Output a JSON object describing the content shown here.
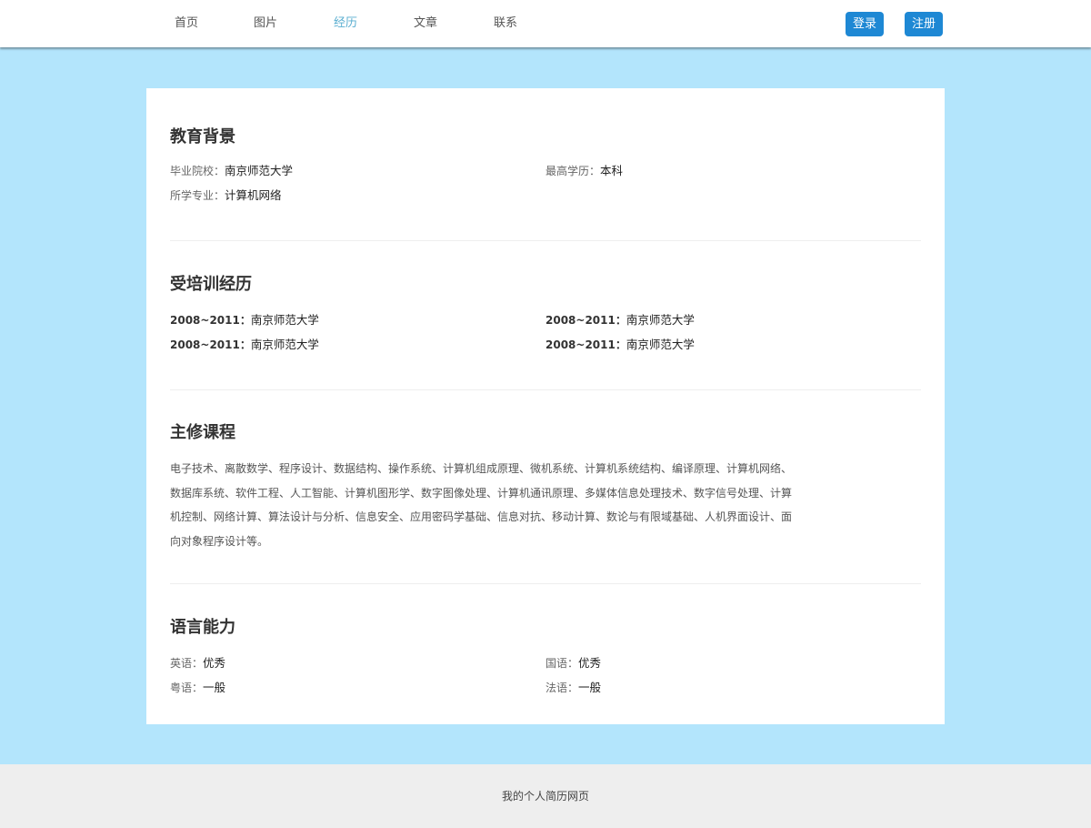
{
  "nav": {
    "items": [
      "首页",
      "图片",
      "经历",
      "文章",
      "联系"
    ],
    "active": "经历",
    "login_label": "登录",
    "register_label": "注册"
  },
  "education": {
    "title": "教育背景",
    "school_label": "毕业院校：",
    "school_value": "南京师范大学",
    "degree_label": "最高学历：",
    "degree_value": "本科",
    "major_label": "所学专业：",
    "major_value": "计算机网络"
  },
  "training": {
    "title": "受培训经历",
    "items": [
      {
        "period": "2008~2011：",
        "place": "南京师范大学"
      },
      {
        "period": "2008~2011：",
        "place": "南京师范大学"
      },
      {
        "period": "2008~2011：",
        "place": "南京师范大学"
      },
      {
        "period": "2008~2011：",
        "place": "南京师范大学"
      }
    ]
  },
  "courses": {
    "title": "主修课程",
    "lines": [
      "电子技术、离散数学、程序设计、数据结构、操作系统、计算机组成原理、微机系统、计算机系统结构、编译原理、计算机网络、",
      "数据库系统、软件工程、人工智能、计算机图形学、数字图像处理、计算机通讯原理、多媒体信息处理技术、数字信号处理、计算",
      "机控制、网络计算、算法设计与分析、信息安全、应用密码学基础、信息对抗、移动计算、数论与有限域基础、人机界面设计、面",
      "向对象程序设计等。"
    ]
  },
  "languages": {
    "title": "语言能力",
    "items": [
      {
        "label": "英语：",
        "value": "优秀"
      },
      {
        "label": "国语：",
        "value": "优秀"
      },
      {
        "label": "粤语：",
        "value": "一般"
      },
      {
        "label": "法语：",
        "value": "一般"
      }
    ]
  },
  "footer": {
    "text": "我的个人简历网页"
  },
  "colors": {
    "page_bg": "#b3e5fc",
    "button": "#1e88d4",
    "nav_active": "#5aaed0",
    "footer_bg": "#eeeeee"
  }
}
